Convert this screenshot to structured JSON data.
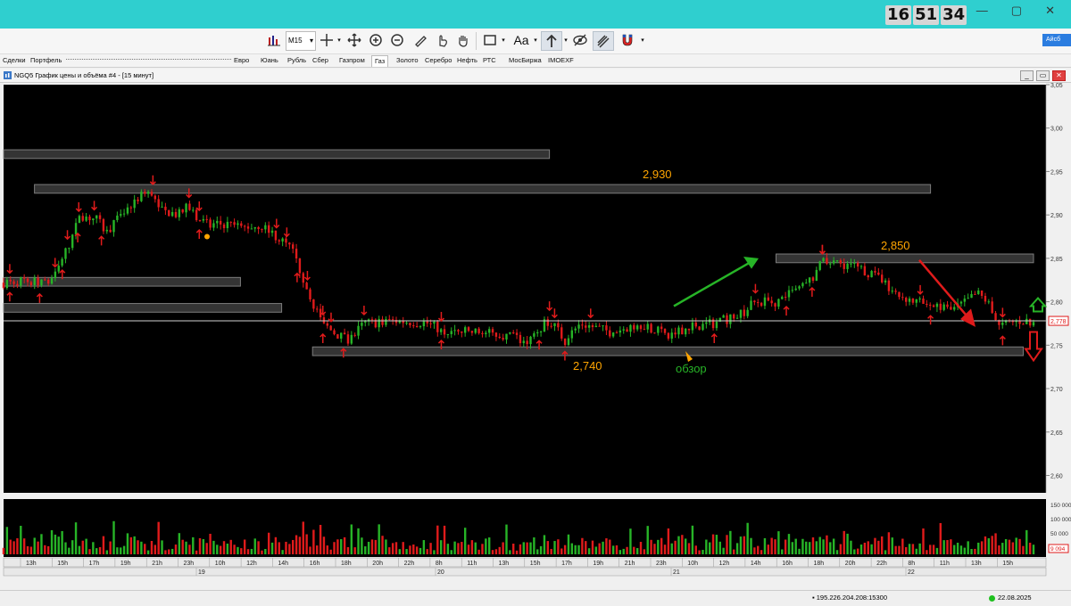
{
  "clock": {
    "h": "16",
    "m": "51",
    "s": "34"
  },
  "toolbar": {
    "timeframe": "M15",
    "text_tool": "Aa",
    "right_button": "Айсб"
  },
  "tabs": [
    "Сделки",
    "Портфель",
    "Евро",
    "Юань",
    "Рубль",
    "Сбер",
    "Газпром",
    "Газ",
    "Золото",
    "Серебро",
    "Нефть",
    "РТС",
    "МосБиржа",
    "IMOEXF"
  ],
  "active_tab": "Газ",
  "window": {
    "title": "NGQ5 График цены и объёма #4 - [15 минут]"
  },
  "colors": {
    "up": "#27b427",
    "down": "#e01b1b",
    "level": "#ffa500",
    "zone_fill": "#3a3a3a",
    "zone_border": "#8a8a8a",
    "arrow_green": "#27b427",
    "arrow_red": "#e01b1b"
  },
  "chart_data": {
    "type": "candlestick",
    "symbol": "NGQ5",
    "timeframe": "15 минут",
    "ylim": [
      2.58,
      3.05
    ],
    "y_ticks": [
      "3,05",
      "3,00",
      "2,95",
      "2,90",
      "2,85",
      "2,80",
      "2,75",
      "2,70",
      "2,65",
      "2,60"
    ],
    "y_tick_values": [
      3.05,
      3.0,
      2.95,
      2.9,
      2.85,
      2.8,
      2.75,
      2.7,
      2.65,
      2.6
    ],
    "last_price": "2,778",
    "last_price_value": 2.778,
    "time_labels": [
      "13h",
      "15h",
      "17h",
      "19h",
      "21h",
      "23h",
      "10h",
      "12h",
      "14h",
      "16h",
      "18h",
      "20h",
      "22h",
      "8h",
      "11h",
      "13h",
      "15h",
      "17h",
      "19h",
      "21h",
      "23h",
      "10h",
      "12h",
      "14h",
      "16h",
      "18h",
      "20h",
      "22h",
      "8h",
      "11h",
      "13h",
      "15h"
    ],
    "date_labels": [
      "19",
      "20",
      "21",
      "22"
    ],
    "volume_ticks": [
      "150 000",
      "100 000",
      "50 000"
    ],
    "volume_ylim": [
      0,
      175000
    ],
    "volume_last": "9 094",
    "annotations": {
      "level_2930": "2,930",
      "level_2850": "2,850",
      "level_2740": "2,740",
      "review": "обзор"
    },
    "zones": [
      {
        "from": 0.0,
        "to": 0.53,
        "low": 2.965,
        "high": 2.975
      },
      {
        "from": 0.03,
        "to": 0.9,
        "low": 2.925,
        "high": 2.935
      },
      {
        "from": 0.0,
        "to": 0.23,
        "low": 2.818,
        "high": 2.828
      },
      {
        "from": 0.0,
        "to": 0.27,
        "low": 2.788,
        "high": 2.798
      },
      {
        "from": 0.75,
        "to": 1.0,
        "low": 2.845,
        "high": 2.855
      },
      {
        "from": 0.3,
        "to": 0.99,
        "low": 2.738,
        "high": 2.748
      }
    ],
    "close_path": [
      [
        0,
        2.822
      ],
      [
        0.02,
        2.825
      ],
      [
        0.04,
        2.82
      ],
      [
        0.05,
        2.83
      ],
      [
        0.065,
        2.87
      ],
      [
        0.075,
        2.9
      ],
      [
        0.09,
        2.895
      ],
      [
        0.1,
        2.88
      ],
      [
        0.115,
        2.9
      ],
      [
        0.13,
        2.92
      ],
      [
        0.145,
        2.925
      ],
      [
        0.155,
        2.905
      ],
      [
        0.17,
        2.9
      ],
      [
        0.18,
        2.91
      ],
      [
        0.19,
        2.895
      ],
      [
        0.2,
        2.887
      ],
      [
        0.215,
        2.89
      ],
      [
        0.23,
        2.885
      ],
      [
        0.25,
        2.888
      ],
      [
        0.265,
        2.875
      ],
      [
        0.28,
        2.86
      ],
      [
        0.29,
        2.83
      ],
      [
        0.3,
        2.8
      ],
      [
        0.31,
        2.775
      ],
      [
        0.32,
        2.765
      ],
      [
        0.335,
        2.755
      ],
      [
        0.35,
        2.775
      ],
      [
        0.38,
        2.778
      ],
      [
        0.41,
        2.776
      ],
      [
        0.43,
        2.765
      ],
      [
        0.46,
        2.765
      ],
      [
        0.48,
        2.762
      ],
      [
        0.51,
        2.755
      ],
      [
        0.53,
        2.78
      ],
      [
        0.545,
        2.755
      ],
      [
        0.56,
        2.775
      ],
      [
        0.59,
        2.765
      ],
      [
        0.62,
        2.775
      ],
      [
        0.645,
        2.76
      ],
      [
        0.665,
        2.772
      ],
      [
        0.69,
        2.775
      ],
      [
        0.715,
        2.785
      ],
      [
        0.73,
        2.8
      ],
      [
        0.75,
        2.8
      ],
      [
        0.765,
        2.81
      ],
      [
        0.78,
        2.82
      ],
      [
        0.795,
        2.845
      ],
      [
        0.81,
        2.845
      ],
      [
        0.83,
        2.84
      ],
      [
        0.845,
        2.83
      ],
      [
        0.865,
        2.81
      ],
      [
        0.885,
        2.8
      ],
      [
        0.905,
        2.795
      ],
      [
        0.92,
        2.79
      ],
      [
        0.935,
        2.8
      ],
      [
        0.945,
        2.81
      ],
      [
        0.955,
        2.8
      ],
      [
        0.965,
        2.77
      ],
      [
        0.975,
        2.775
      ],
      [
        0.985,
        2.778
      ]
    ]
  }
}
